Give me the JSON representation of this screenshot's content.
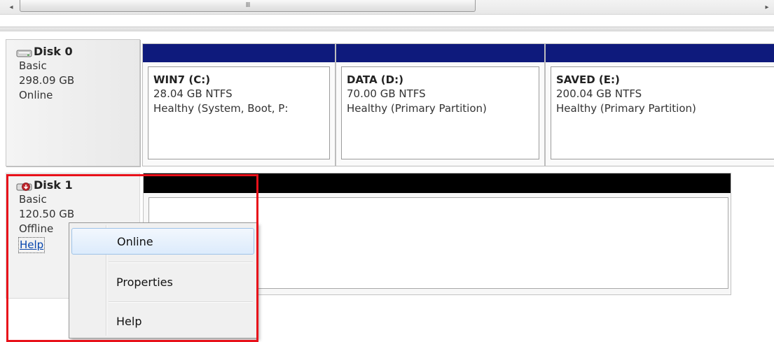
{
  "scrollbar": {
    "left_arrow": "◂",
    "right_arrow": "▸",
    "grip": "III"
  },
  "disks": [
    {
      "name": "Disk 0",
      "type": "Basic",
      "size": "298.09 GB",
      "status": "Online",
      "partitions": [
        {
          "name": "WIN7  (C:)",
          "info": "28.04 GB NTFS",
          "status": "Healthy (System, Boot, P:"
        },
        {
          "name": "DATA  (D:)",
          "info": "70.00 GB NTFS",
          "status": "Healthy (Primary Partition)"
        },
        {
          "name": "SAVED  (E:)",
          "info": "200.04 GB NTFS",
          "status": "Healthy (Primary Partition)"
        }
      ]
    },
    {
      "name": "Disk 1",
      "type": "Basic",
      "size": "120.50 GB",
      "status": "Offline",
      "help": "Help"
    }
  ],
  "context_menu": {
    "items": [
      "Online",
      "Properties",
      "Help"
    ]
  },
  "colors": {
    "partition_header": "#0e1a7c",
    "unallocated_header": "#000000",
    "highlight": "#e8111a"
  }
}
